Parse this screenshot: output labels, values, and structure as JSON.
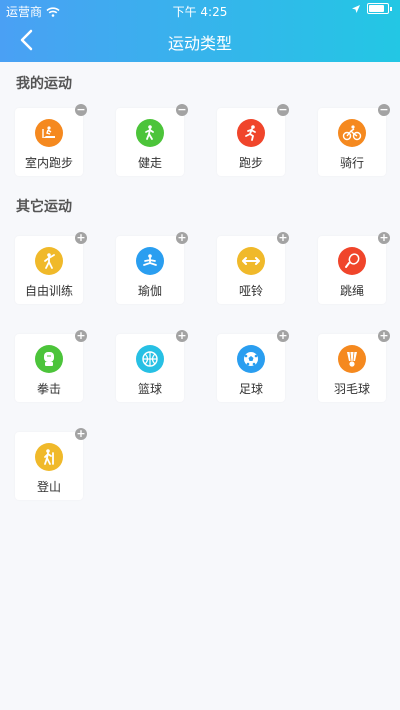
{
  "status_bar": {
    "carrier": "运营商",
    "time": "下午 4:25"
  },
  "nav": {
    "title": "运动类型"
  },
  "my_section": {
    "title": "我的运动",
    "items": [
      {
        "label": "室内跑步",
        "icon": "treadmill-icon",
        "color": "#f5891f",
        "badge": "−"
      },
      {
        "label": "健走",
        "icon": "walking-icon",
        "color": "#4cc43a",
        "badge": "−"
      },
      {
        "label": "跑步",
        "icon": "running-icon",
        "color": "#f0452b",
        "badge": "−"
      },
      {
        "label": "骑行",
        "icon": "cycling-icon",
        "color": "#f5891f",
        "badge": "−"
      }
    ]
  },
  "other_section": {
    "title": "其它运动",
    "items": [
      {
        "label": "自由训练",
        "icon": "free-training-icon",
        "color": "#f0b92a",
        "badge": "+"
      },
      {
        "label": "瑜伽",
        "icon": "yoga-icon",
        "color": "#2a9ef0",
        "badge": "+"
      },
      {
        "label": "哑铃",
        "icon": "dumbbell-icon",
        "color": "#f0b92a",
        "badge": "+"
      },
      {
        "label": "跳绳",
        "icon": "jump-rope-icon",
        "color": "#f0452b",
        "badge": "+"
      },
      {
        "label": "拳击",
        "icon": "boxing-glove-icon",
        "color": "#4cc43a",
        "badge": "+"
      },
      {
        "label": "篮球",
        "icon": "basketball-icon",
        "color": "#27c0e4",
        "badge": "+"
      },
      {
        "label": "足球",
        "icon": "soccer-ball-icon",
        "color": "#2a9ef0",
        "badge": "+"
      },
      {
        "label": "羽毛球",
        "icon": "shuttlecock-icon",
        "color": "#f5891f",
        "badge": "+"
      },
      {
        "label": "登山",
        "icon": "hiking-icon",
        "color": "#f0b92a",
        "badge": "+"
      }
    ]
  }
}
